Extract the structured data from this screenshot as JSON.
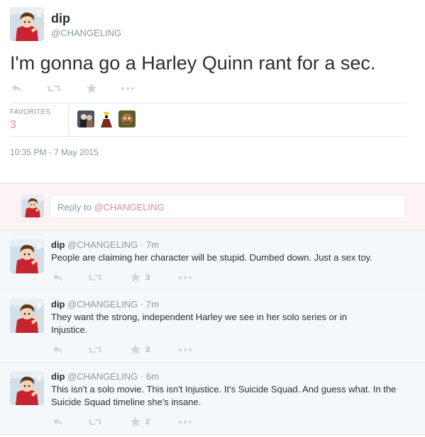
{
  "main_tweet": {
    "name": "dip",
    "handle": "@CHANGELING",
    "text": "I'm gonna go a Harley Quinn rant for a sec.",
    "favorites_label": "FAVORITES",
    "favorites_count": "3",
    "timestamp": "10:35 PM - 7 May 2015",
    "actions": [
      "reply-icon",
      "retweet-icon",
      "star-icon",
      "more-icon"
    ]
  },
  "reply_box": {
    "prefix": "Reply to ",
    "mention": "@CHANGELING"
  },
  "replies": [
    {
      "name": "dip",
      "handle": "@CHANGELING",
      "time": "· 7m",
      "text": "People are claiming her character will be stupid. Dumbed down. Just a sex toy.",
      "favorites": "3"
    },
    {
      "name": "dip",
      "handle": "@CHANGELING",
      "time": "· 7m",
      "text": "They want the strong, independent Harley we see in her solo series or in Injustice.",
      "favorites": "3"
    },
    {
      "name": "dip",
      "handle": "@CHANGELING",
      "time": "· 6m",
      "text": "This isn't a solo movie. This isn't Injustice. It's Suicide Squad. And guess what. In the Suicide Squad timeline she's insane.",
      "favorites": "2"
    }
  ],
  "colors": {
    "accent_pink": "#e0899a",
    "muted_text": "#8899a6",
    "icon_gray": "#ccd6dd",
    "reply_bg": "#f5f8fa"
  }
}
